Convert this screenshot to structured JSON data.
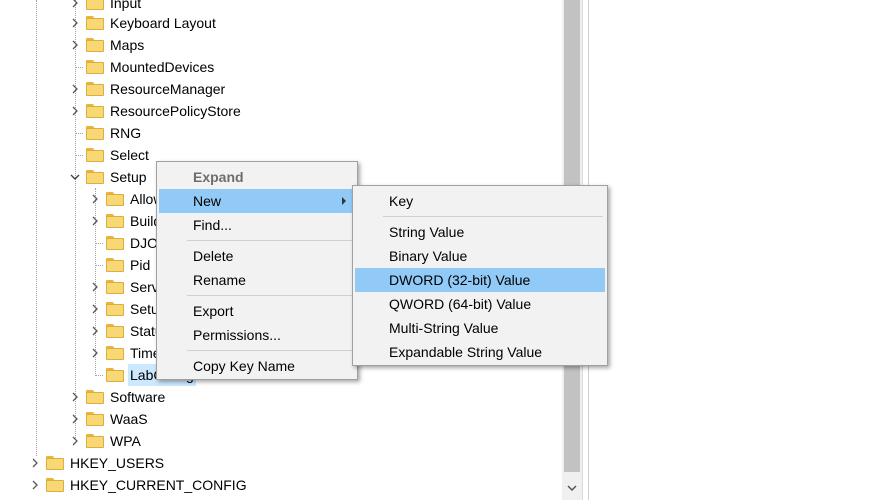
{
  "tree": {
    "rows": [
      {
        "label": "Input"
      },
      {
        "label": "Keyboard Layout"
      },
      {
        "label": "Maps"
      },
      {
        "label": "MountedDevices"
      },
      {
        "label": "ResourceManager"
      },
      {
        "label": "ResourcePolicyStore"
      },
      {
        "label": "RNG"
      },
      {
        "label": "Select"
      },
      {
        "label": "Setup"
      },
      {
        "label": "AllowStart"
      },
      {
        "label": "BuildUpdate"
      },
      {
        "label": "DJOIN"
      },
      {
        "label": "Pid"
      },
      {
        "label": "Service"
      },
      {
        "label": "SetupCl"
      },
      {
        "label": "Status"
      },
      {
        "label": "Timers"
      },
      {
        "label": "LabConfig"
      },
      {
        "label": "Software"
      },
      {
        "label": "WaaS"
      },
      {
        "label": "WPA"
      },
      {
        "label": "HKEY_USERS"
      },
      {
        "label": "HKEY_CURRENT_CONFIG"
      }
    ]
  },
  "context_menu": {
    "items": [
      {
        "label": "Expand"
      },
      {
        "label": "New"
      },
      {
        "label": "Find..."
      },
      {
        "label": "Delete"
      },
      {
        "label": "Rename"
      },
      {
        "label": "Export"
      },
      {
        "label": "Permissions..."
      },
      {
        "label": "Copy Key Name"
      }
    ]
  },
  "submenu": {
    "items": [
      {
        "label": "Key"
      },
      {
        "label": "String Value"
      },
      {
        "label": "Binary Value"
      },
      {
        "label": "DWORD (32-bit) Value"
      },
      {
        "label": "QWORD (64-bit) Value"
      },
      {
        "label": "Multi-String Value"
      },
      {
        "label": "Expandable String Value"
      }
    ]
  },
  "colors": {
    "menu_highlight": "#91c9f7",
    "selection": "#cce8ff",
    "folder": "#f8d775"
  }
}
